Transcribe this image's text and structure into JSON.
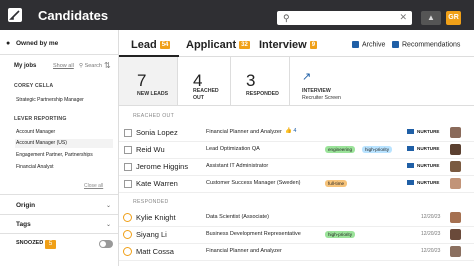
{
  "app": {
    "title": "Candidates",
    "avatar_initials": "GR"
  },
  "search": {
    "placeholder": ""
  },
  "sidebar": {
    "owned_label": "Owned by me",
    "my_jobs": "My jobs",
    "show_all": "Show all",
    "search": "Search",
    "groups": [
      {
        "title": "COREY CELLA",
        "items": [
          "Strategic Partnership Manager"
        ]
      },
      {
        "title": "LEVER REPORTING",
        "items": [
          "Account Manager",
          "Account Manager (US)",
          "Engagement Partner, Partnerships",
          "Financial Analyst"
        ]
      }
    ],
    "close": "Close all",
    "filters": [
      "Origin",
      "Tags"
    ],
    "snoozed_label": "SNOOZED",
    "snoozed_count": "5"
  },
  "tabs": [
    {
      "label": "Lead",
      "badge": "54"
    },
    {
      "label": "Applicant",
      "badge": "32"
    },
    {
      "label": "Interview",
      "badge": "9"
    }
  ],
  "header_buttons": {
    "archive": "Archive",
    "recommendations": "Recommendations"
  },
  "pipeline": [
    {
      "num": "7",
      "label": "NEW LEADS"
    },
    {
      "num": "4",
      "label": "REACHED\nOUT"
    },
    {
      "num": "3",
      "label": "RESPONDED"
    },
    {
      "num": "",
      "label": "INTERVIEW",
      "sub": "Recruiter Screen"
    }
  ],
  "sections": {
    "reached_out": "REACHED OUT",
    "responded": "RESPONDED"
  },
  "reached_out_rows": [
    {
      "name": "Sonia Lopez",
      "job": "Financial Planner and Analyzer",
      "thumbs": "👍 4",
      "tags": [],
      "status": "NURTURE",
      "face_color": "#8a6a5a"
    },
    {
      "name": "Reid Wu",
      "job": "Lead Optimization QA",
      "tags": [
        {
          "text": "engineering",
          "color": "#9be39a"
        },
        {
          "text": "high-priority",
          "color": "#b9e3ff"
        }
      ],
      "status": "NURTURE",
      "face_color": "#5b4030"
    },
    {
      "name": "Jerome Higgins",
      "job": "Assistant IT Administrator",
      "tags": [],
      "status": "NURTURE",
      "face_color": "#7a5a40"
    },
    {
      "name": "Kate Warren",
      "job": "Customer Success Manager (Sweden)",
      "tags": [
        {
          "text": "full-time",
          "color": "#f6c37a"
        }
      ],
      "status": "NURTURE",
      "face_color": "#c29478"
    }
  ],
  "responded_rows": [
    {
      "name": "Kylie Knight",
      "job": "Data Scientist (Associate)",
      "tags": [],
      "date": "12/20/23",
      "face_color": "#a57050"
    },
    {
      "name": "Siyang Li",
      "job": "Business Development Representative",
      "tags": [
        {
          "text": "high-priority",
          "color": "#9be39a"
        }
      ],
      "date": "12/20/23",
      "face_color": "#6a4a3a"
    },
    {
      "name": "Matt Cossa",
      "job": "Financial Planner and Analyzer",
      "tags": [],
      "date": "12/20/23",
      "face_color": "#8b7060"
    }
  ]
}
